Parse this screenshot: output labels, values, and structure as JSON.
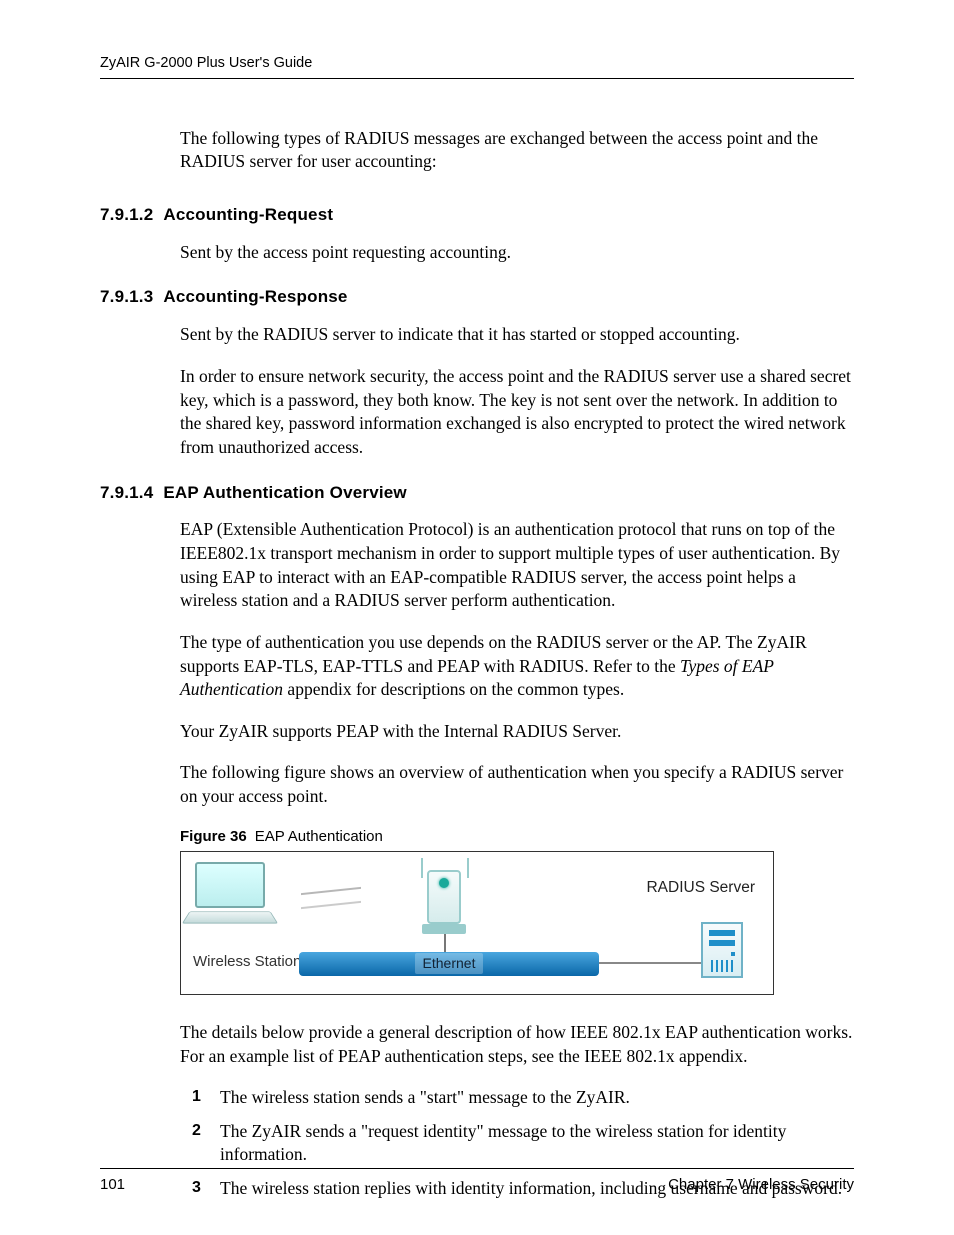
{
  "header": {
    "guide_title": "ZyAIR G-2000 Plus User's Guide"
  },
  "intro_para": "The following types of RADIUS messages are exchanged between the access point and the RADIUS server for user accounting:",
  "sections": {
    "s1": {
      "num": "7.9.1.2",
      "title": "Accounting-Request",
      "p1": "Sent by the access point requesting accounting."
    },
    "s2": {
      "num": "7.9.1.3",
      "title": "Accounting-Response",
      "p1": "Sent by the RADIUS server to indicate that it has started or stopped accounting.",
      "p2": "In order to ensure network security, the access point and the RADIUS server use a shared secret key, which is a password, they both know. The key is not sent over the network. In addition to the shared key, password information exchanged is also encrypted to protect the wired network from unauthorized access."
    },
    "s3": {
      "num": "7.9.1.4",
      "title": "EAP Authentication Overview",
      "p1": "EAP (Extensible Authentication Protocol) is an authentication protocol that runs on top of the IEEE802.1x transport mechanism in order to support multiple types of user authentication. By using EAP to interact with an EAP-compatible RADIUS server, the access point helps a wireless station and a RADIUS server perform authentication.",
      "p2_a": "The type of authentication you use depends on the RADIUS server or the AP. The ZyAIR supports EAP-TLS, EAP-TTLS and PEAP with RADIUS. Refer to the ",
      "p2_italic": "Types of EAP Authentication",
      "p2_b": " appendix for descriptions on the common types.",
      "p3": "Your ZyAIR supports PEAP with the Internal RADIUS Server.",
      "p4": "The following figure shows an overview of authentication when you specify a RADIUS server on your access point."
    }
  },
  "figure": {
    "num": "Figure 36",
    "title": "EAP Authentication",
    "labels": {
      "wireless_station": "Wireless Station",
      "ethernet": "Ethernet",
      "radius_server": "RADIUS Server"
    }
  },
  "post_figure_para": "The details below provide a general description of how IEEE 802.1x EAP authentication works. For an example list of PEAP authentication steps, see the IEEE 802.1x appendix.",
  "steps": {
    "1": "The wireless station sends a \"start\" message to the ZyAIR.",
    "2": "The ZyAIR sends a \"request identity\" message to the wireless station for identity information.",
    "3": "The wireless station replies with identity information, including username and password."
  },
  "footer": {
    "page_number": "101",
    "chapter": "Chapter 7 Wireless Security"
  }
}
